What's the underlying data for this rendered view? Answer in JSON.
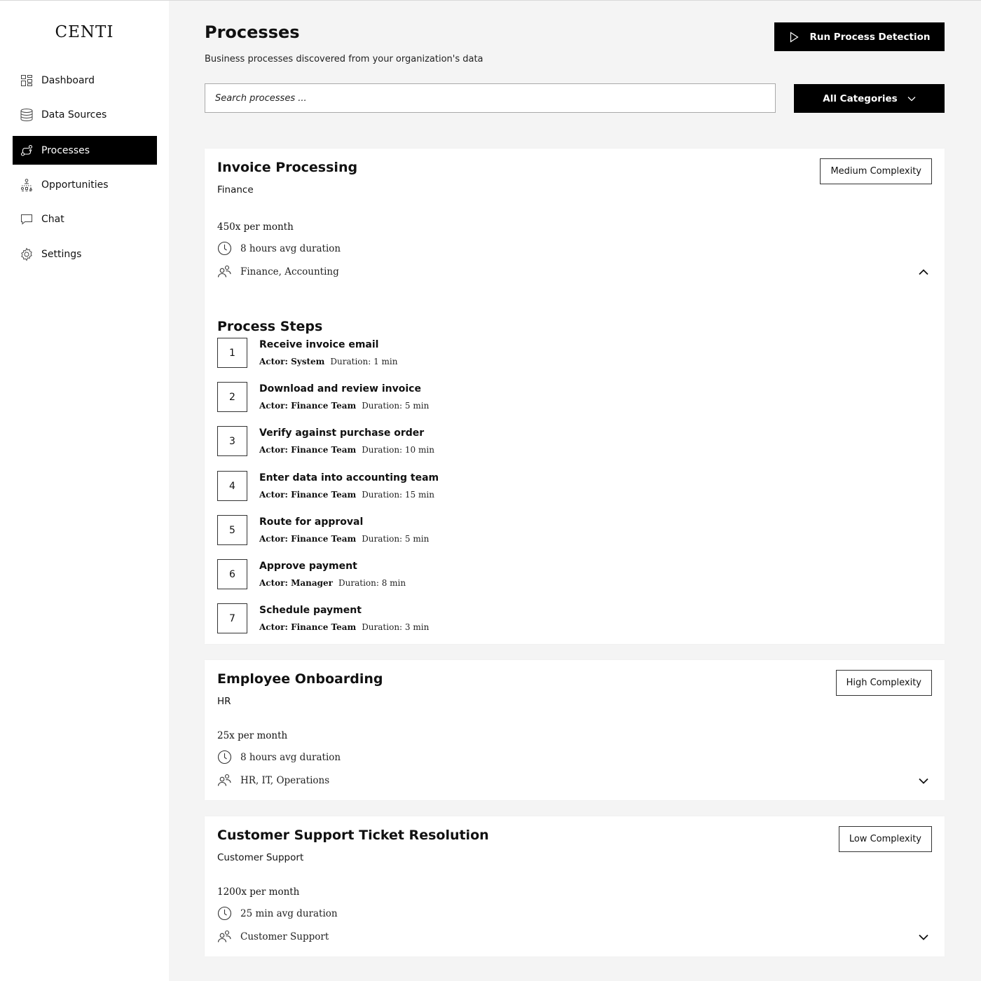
{
  "app": {
    "logo": "CENTI"
  },
  "sidebar": {
    "items": [
      {
        "label": "Dashboard",
        "icon": "dashboard-icon",
        "active": false
      },
      {
        "label": "Data Sources",
        "icon": "database-icon",
        "active": false
      },
      {
        "label": "Processes",
        "icon": "process-icon",
        "active": true
      },
      {
        "label": "Opportunities",
        "icon": "opportunities-icon",
        "active": false
      },
      {
        "label": "Chat",
        "icon": "chat-icon",
        "active": false
      },
      {
        "label": "Settings",
        "icon": "gear-icon",
        "active": false
      }
    ]
  },
  "header": {
    "title": "Processes",
    "subtitle": "Business processes discovered from your organization's data",
    "run_button": "Run Process Detection"
  },
  "filters": {
    "search_placeholder": "Search processes ...",
    "category_button": "All Categories"
  },
  "processes": [
    {
      "title": "Invoice Processing",
      "category": "Finance",
      "complexity": "Medium Complexity",
      "frequency": "450x per month",
      "duration": "8 hours avg duration",
      "departments": "Finance, Accounting",
      "expanded": true,
      "steps_title": "Process Steps",
      "steps": [
        {
          "num": "1",
          "name": "Receive invoice email",
          "actor": "Actor: System",
          "duration": "Duration: 1 min"
        },
        {
          "num": "2",
          "name": "Download and review invoice",
          "actor": "Actor: Finance Team",
          "duration": "Duration: 5 min"
        },
        {
          "num": "3",
          "name": "Verify against purchase order",
          "actor": "Actor: Finance Team",
          "duration": "Duration: 10 min"
        },
        {
          "num": "4",
          "name": "Enter data into accounting team",
          "actor": "Actor: Finance Team",
          "duration": "Duration: 15 min"
        },
        {
          "num": "5",
          "name": "Route for approval",
          "actor": "Actor: Finance Team",
          "duration": "Duration: 5 min"
        },
        {
          "num": "6",
          "name": "Approve payment",
          "actor": "Actor: Manager",
          "duration": "Duration: 8 min"
        },
        {
          "num": "7",
          "name": "Schedule payment",
          "actor": "Actor: Finance Team",
          "duration": "Duration: 3 min"
        }
      ]
    },
    {
      "title": "Employee Onboarding",
      "category": "HR",
      "complexity": "High Complexity",
      "frequency": "25x per month",
      "duration": "8 hours avg duration",
      "departments": "HR, IT, Operations",
      "expanded": false
    },
    {
      "title": "Customer Support Ticket Resolution",
      "category": "Customer Support",
      "complexity": "Low Complexity",
      "frequency": "1200x per month",
      "duration": "25 min avg duration",
      "departments": "Customer Support",
      "expanded": false
    }
  ]
}
